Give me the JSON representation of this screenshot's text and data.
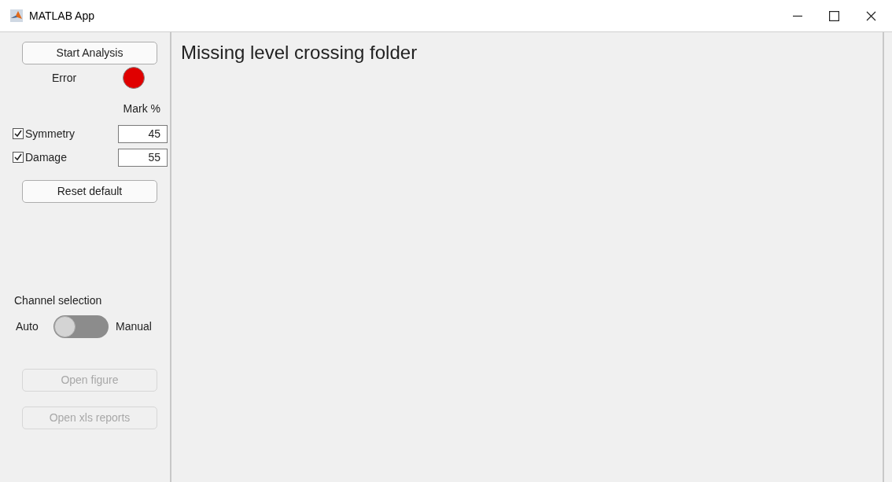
{
  "window": {
    "title": "MATLAB App"
  },
  "sidebar": {
    "start_button": {
      "label": "Start Analysis",
      "disabled": false
    },
    "status": {
      "label": "Error",
      "color": "#e00000"
    },
    "mark_header": "Mark %",
    "criteria": [
      {
        "label": "Symmetry",
        "checked": true,
        "value": "45"
      },
      {
        "label": "Damage",
        "checked": true,
        "value": "55"
      }
    ],
    "reset_button": {
      "label": "Reset default",
      "disabled": false
    },
    "channel_selection": {
      "label": "Channel selection",
      "left": "Auto",
      "right": "Manual",
      "on": false
    },
    "buttons": [
      {
        "label": "Open figure",
        "disabled": true
      },
      {
        "label": "Open xls reports",
        "disabled": true
      }
    ]
  },
  "main": {
    "message": "Missing level crossing folder"
  }
}
